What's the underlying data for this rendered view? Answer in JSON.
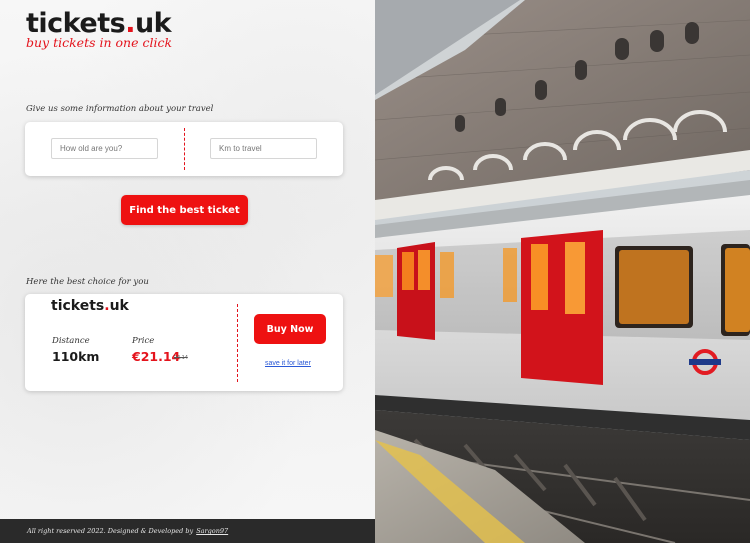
{
  "brand": {
    "name_main": "tickets",
    "name_dot": ".",
    "name_tld": "uk",
    "tagline": "buy tickets in one click"
  },
  "form": {
    "section_label": "Give us some information about your travel",
    "age_placeholder": "How old are you?",
    "km_placeholder": "Km to travel",
    "submit_label": "Find the best ticket"
  },
  "result": {
    "section_label": "Here the best choice for you",
    "logo_main": "tickets",
    "logo_dot": ".",
    "logo_tld": "uk",
    "distance_label": "Distance",
    "distance_value": "110km",
    "price_label": "Price",
    "price_value": "€21.14",
    "old_price": "24.14",
    "buy_label": "Buy Now",
    "save_label": "save it for later"
  },
  "footer": {
    "text": "All right reserved 2022. Designed & Developed by",
    "author": "Sargon97"
  },
  "photo": {
    "subject": "London Underground train at station platform",
    "roundel_text": "UNDERGROUND"
  },
  "colors": {
    "accent": "#e4131c",
    "footer_bg": "#2a2a2a",
    "link": "#2a58d6"
  }
}
